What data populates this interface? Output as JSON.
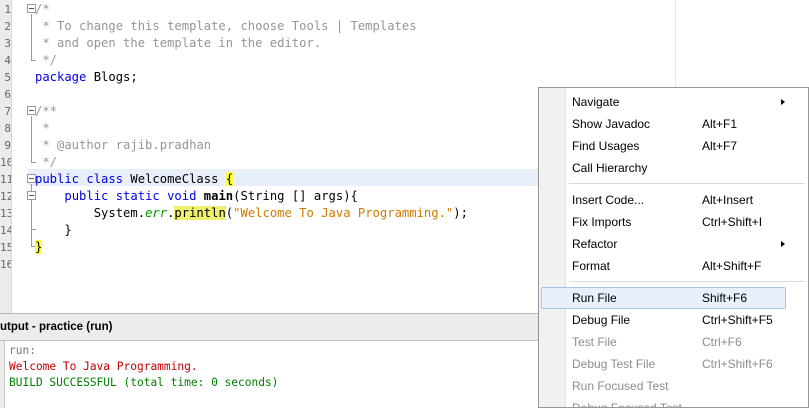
{
  "editor": {
    "line_numbers": [
      "1",
      "2",
      "3",
      "4",
      "5",
      "6",
      "7",
      "8",
      "9",
      "10",
      "11",
      "12",
      "13",
      "14",
      "15",
      "16"
    ],
    "lines": [
      [
        {
          "t": "/*",
          "c": "cm"
        }
      ],
      [
        {
          "t": " * To change this template, choose Tools | Templates",
          "c": "cm"
        }
      ],
      [
        {
          "t": " * and open the template in the editor.",
          "c": "cm"
        }
      ],
      [
        {
          "t": " */",
          "c": "cm"
        }
      ],
      [
        {
          "t": "package",
          "c": "kw"
        },
        {
          "t": " Blogs;",
          "c": ""
        }
      ],
      [],
      [
        {
          "t": "/**",
          "c": "cm"
        }
      ],
      [
        {
          "t": " *",
          "c": "cm"
        }
      ],
      [
        {
          "t": " * @author rajib.pradhan",
          "c": "cm"
        }
      ],
      [
        {
          "t": " */",
          "c": "cm"
        }
      ],
      [
        {
          "t": "public class",
          "c": "kw"
        },
        {
          "t": " WelcomeClass ",
          "c": ""
        },
        {
          "t": "{",
          "c": "hl"
        }
      ],
      [
        {
          "t": "    ",
          "c": ""
        },
        {
          "t": "public static void",
          "c": "kw"
        },
        {
          "t": " ",
          "c": ""
        },
        {
          "t": "main",
          "c": "mth"
        },
        {
          "t": "(String [] args){",
          "c": ""
        }
      ],
      [
        {
          "t": "        System.",
          "c": ""
        },
        {
          "t": "err",
          "c": "fld"
        },
        {
          "t": ".",
          "c": ""
        },
        {
          "t": "println",
          "c": "hl2"
        },
        {
          "t": "(",
          "c": ""
        },
        {
          "t": "\"Welcome To Java Programming.\"",
          "c": "str"
        },
        {
          "t": ");",
          "c": ""
        }
      ],
      [
        {
          "t": "    }",
          "c": ""
        }
      ],
      [
        {
          "t": "}",
          "c": "hl"
        }
      ],
      []
    ]
  },
  "output": {
    "title": "utput - practice (run)",
    "lines": [
      {
        "text": "run:",
        "kind": "run"
      },
      {
        "text": "Welcome To Java Programming.",
        "kind": "err"
      },
      {
        "text": "BUILD SUCCESSFUL (total time: 0 seconds)",
        "kind": "ok"
      }
    ]
  },
  "context_menu": {
    "items": [
      {
        "label": "Navigate",
        "shortcut": "",
        "submenu": true,
        "disabled": false
      },
      {
        "label": "Show Javadoc",
        "shortcut": "Alt+F1",
        "submenu": false,
        "disabled": false
      },
      {
        "label": "Find Usages",
        "shortcut": "Alt+F7",
        "submenu": false,
        "disabled": false
      },
      {
        "label": "Call Hierarchy",
        "shortcut": "",
        "submenu": false,
        "disabled": false
      },
      {
        "separator": true
      },
      {
        "label": "Insert Code...",
        "shortcut": "Alt+Insert",
        "submenu": false,
        "disabled": false
      },
      {
        "label": "Fix Imports",
        "shortcut": "Ctrl+Shift+I",
        "submenu": false,
        "disabled": false
      },
      {
        "label": "Refactor",
        "shortcut": "",
        "submenu": true,
        "disabled": false
      },
      {
        "label": "Format",
        "shortcut": "Alt+Shift+F",
        "submenu": false,
        "disabled": false
      },
      {
        "separator": true
      },
      {
        "label": "Run File",
        "shortcut": "Shift+F6",
        "submenu": false,
        "disabled": false,
        "selected": true
      },
      {
        "label": "Debug File",
        "shortcut": "Ctrl+Shift+F5",
        "submenu": false,
        "disabled": false
      },
      {
        "label": "Test File",
        "shortcut": "Ctrl+F6",
        "submenu": false,
        "disabled": true
      },
      {
        "label": "Debug Test File",
        "shortcut": "Ctrl+Shift+F6",
        "submenu": false,
        "disabled": true
      },
      {
        "label": "Run Focused Test",
        "shortcut": "",
        "submenu": false,
        "disabled": true
      },
      {
        "label": "Debug Focused Test",
        "shortcut": "",
        "submenu": false,
        "disabled": true
      }
    ]
  }
}
